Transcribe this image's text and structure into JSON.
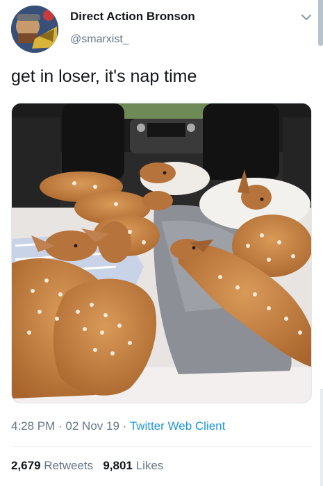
{
  "author": {
    "display_name": "Direct Action Bronson",
    "handle": "@smarxist_"
  },
  "tweet": {
    "text": "get in loser, it's nap time"
  },
  "media": {
    "alt_icon": "photo-of-fawns-napping-in-car-trunk"
  },
  "meta": {
    "time": "4:28 PM",
    "sep1": " · ",
    "date": "02 Nov 19",
    "sep2": " · ",
    "client": "Twitter Web Client"
  },
  "stats": {
    "retweets_count": "2,679",
    "retweets_label": "Retweets",
    "likes_count": "9,801",
    "likes_label": "Likes"
  },
  "colors": {
    "link": "#1b95e0",
    "secondary_text": "#657786",
    "primary_text": "#14171a",
    "divider": "#e6ecf0"
  }
}
